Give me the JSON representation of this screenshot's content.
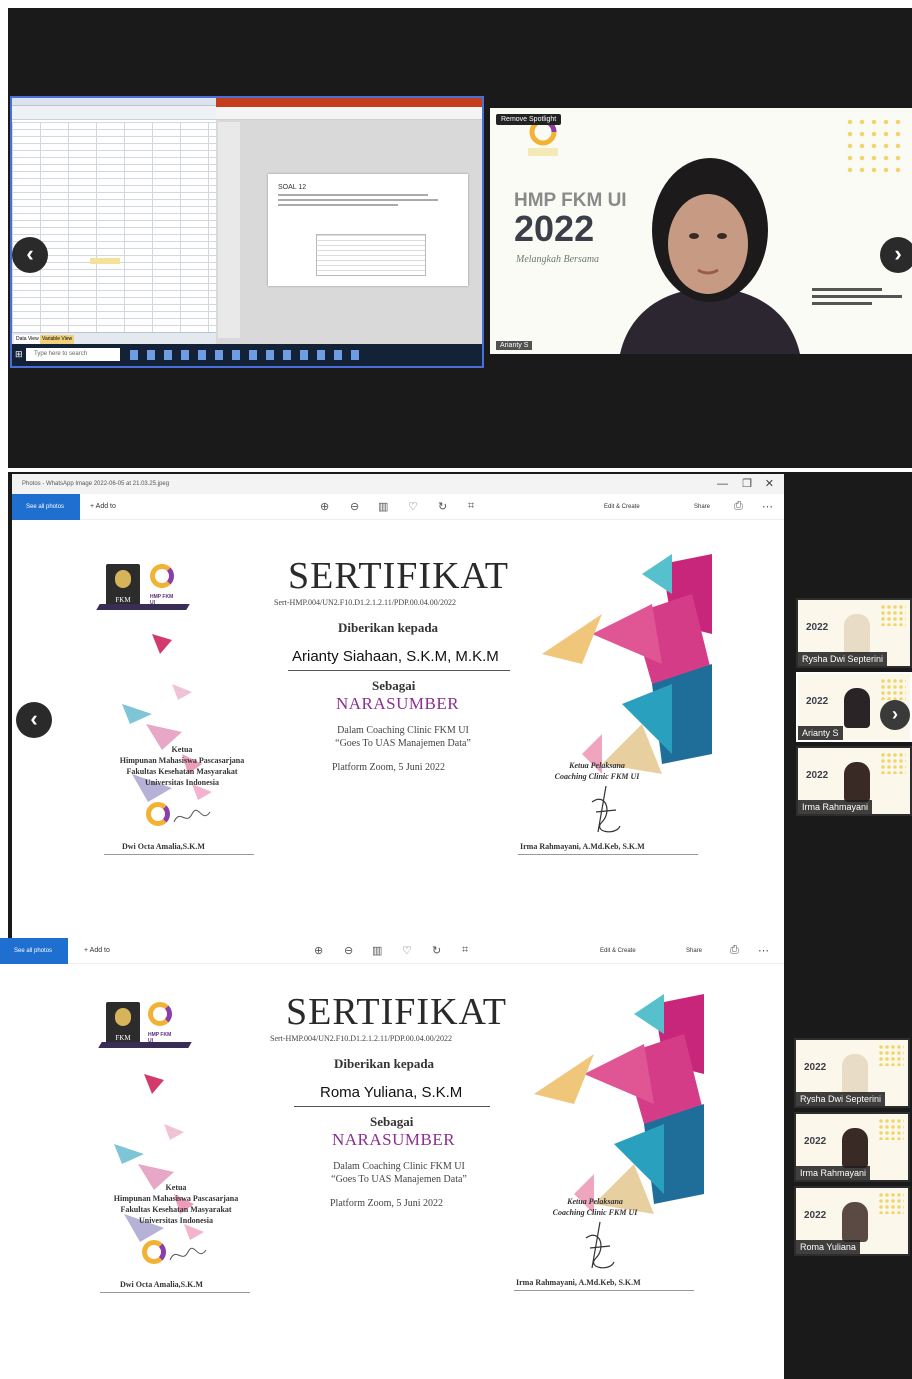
{
  "frame1": {
    "spss": {
      "tabs": [
        "Data View",
        "Variable View"
      ]
    },
    "ppt": {
      "slide_title": "SOAL 12"
    },
    "taskbar": {
      "search_placeholder": "Type here to search"
    },
    "video": {
      "remove_spotlight": "Remove Spotlight",
      "brand": "HMP FKM UI",
      "year": "2022",
      "tagline": "Melangkah Bersama",
      "participant": "Arianty S"
    }
  },
  "photos1": {
    "title": "Photos - WhatsApp Image 2022-06-05 at 21.03.25.jpeg",
    "see_all": "See all photos",
    "add_to": "Add to",
    "edit_create": "Edit & Create",
    "share": "Share"
  },
  "photos2": {
    "see_all": "See all photos",
    "add_to": "Add to",
    "edit_create": "Edit & Create",
    "share": "Share"
  },
  "certificates": [
    {
      "fkm": "FKM",
      "hmp": "HMP FKM UI",
      "title": "SERTIFIKAT",
      "number": "Sert-HMP.004/UN2.F10.D1.2.1.2.11/PDP.00.04.00/2022",
      "given_to": "Diberikan kepada",
      "recipient": "Arianty Siahaan, S.K.M, M.K.M",
      "as": "Sebagai",
      "role": "NARASUMBER",
      "event_line1": "Dalam Coaching Clinic FKM UI",
      "event_line2": "“Goes To UAS Manajemen Data”",
      "date": "Platform Zoom, 5 Juni 2022",
      "left_title": "Ketua\nHimpunan Mahasiswa Pascasarjana\nFakultas Kesehatan Masyarakat\nUniversitas Indonesia",
      "left_signer": "Dwi Octa Amalia,S.K.M",
      "right_title": "Ketua Pelaksana\nCoaching Clinic FKM UI",
      "right_signer": "Irma Rahmayani, A.Md.Keb, S.K.M"
    },
    {
      "fkm": "FKM",
      "hmp": "HMP FKM UI",
      "title": "SERTIFIKAT",
      "number": "Sert-HMP.004/UN2.F10.D1.2.1.2.11/PDP.00.04.00/2022",
      "given_to": "Diberikan kepada",
      "recipient": "Roma Yuliana, S.K.M",
      "as": "Sebagai",
      "role": "NARASUMBER",
      "event_line1": "Dalam Coaching Clinic FKM UI",
      "event_line2": "“Goes To UAS Manajemen Data”",
      "date": "Platform Zoom, 5 Juni 2022",
      "left_title": "Ketua\nHimpunan Mahasiswa Pascasarjana\nFakultas Kesehatan Masyarakat\nUniversitas Indonesia",
      "left_signer": "Dwi Octa Amalia,S.K.M",
      "right_title": "Ketua Pelaksana\nCoaching Clinic FKM UI",
      "right_signer": "Irma Rahmayani, A.Md.Keb, S.K.M"
    }
  ],
  "participants_group1": [
    {
      "name": "Rysha Dwi Septerini",
      "year": "2022"
    },
    {
      "name": "Arianty S",
      "year": "2022"
    },
    {
      "name": "Irma Rahmayani",
      "year": "2022"
    }
  ],
  "participants_group2": [
    {
      "name": "Rysha Dwi Septerini",
      "year": "2022"
    },
    {
      "name": "Irma Rahmayani",
      "year": "2022"
    },
    {
      "name": "Roma Yuliana",
      "year": "2022"
    }
  ],
  "nav": {
    "prev": "‹",
    "next": "›"
  },
  "colors": {
    "accent_blue": "#1f6fd1",
    "role_purple": "#8c2f8f",
    "hmp_gold": "#f2b233",
    "dark_bg": "#1a1a1a"
  }
}
